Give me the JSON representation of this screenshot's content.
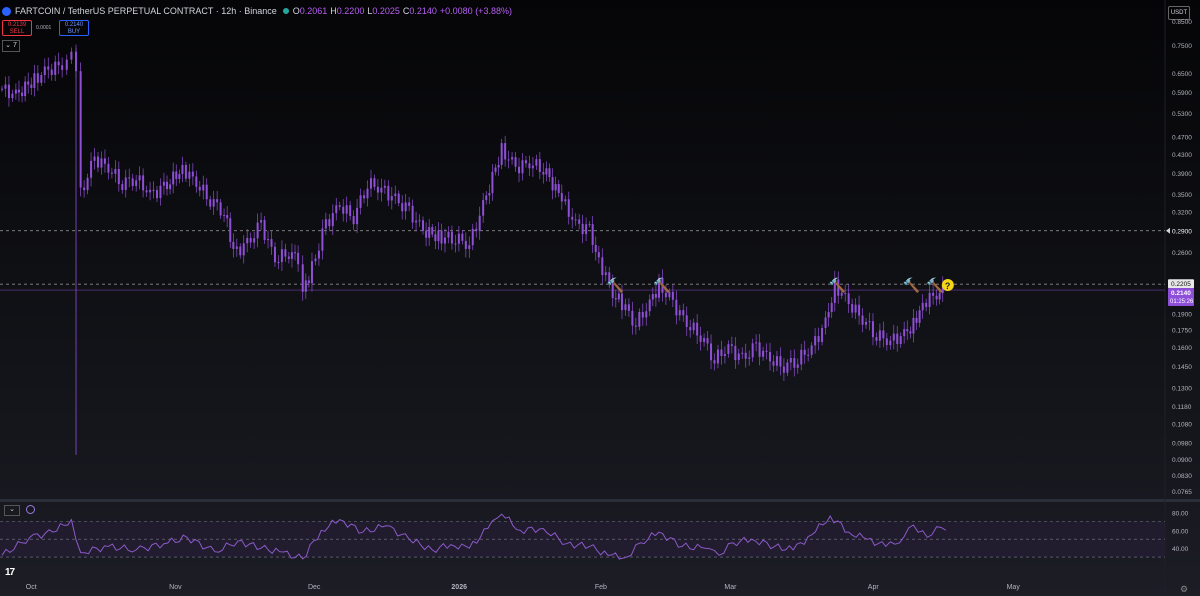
{
  "header": {
    "symbol": "FARTCOIN / TetherUS PERPETUAL CONTRACT · 12h · Binance",
    "open_label": "O",
    "open": "0.2061",
    "high_label": "H",
    "high": "0.2200",
    "low_label": "L",
    "low": "0.2025",
    "close_label": "C",
    "close": "0.2140",
    "change": "+0.0080 (+3.88%)"
  },
  "trade": {
    "sell_price": "0.2139",
    "sell_label": "SELL",
    "spread": "0.0001",
    "buy_price": "0.2140",
    "buy_label": "BUY"
  },
  "indicator_toggle": "7",
  "currency_button": "USDT",
  "colors": {
    "candle": "#8f4fd6",
    "rsi": "#8c59c9",
    "price_label": "#8d4ed8",
    "emoji": "#f5d515"
  },
  "icons": [
    "hammer-emoji-icon",
    "question-emoji-icon",
    "tradingview-logo-icon",
    "settings-gear-icon",
    "collapse-chevron-icon"
  ],
  "chart_data": {
    "type": "line",
    "title": "FARTCOIN / TetherUS PERPETUAL CONTRACT · 12h · Binance",
    "xlabel": "",
    "ylabel": "",
    "log_scale": true,
    "ylim": [
      0.073,
      0.88
    ],
    "x_ticks": [
      "Oct",
      "Nov",
      "Dec",
      "2026",
      "Feb",
      "Mar",
      "Apr",
      "May"
    ],
    "y_ticks": [
      "0.8500",
      "0.7500",
      "0.6500",
      "0.5900",
      "0.5300",
      "0.4700",
      "0.4300",
      "0.3900",
      "0.3500",
      "0.3200",
      "0.2900",
      "0.2600",
      "0.1900",
      "0.1750",
      "0.1600",
      "0.1450",
      "0.1300",
      "0.1180",
      "0.1080",
      "0.0980",
      "0.0900",
      "0.0830",
      "0.0765"
    ],
    "price_levels": {
      "dashed_resistance": "0.2900",
      "dashed_level": "0.2205",
      "last_price": "0.2140",
      "countdown": "01:25:26"
    },
    "series": [
      {
        "values": [
          [
            "2025-09-25",
            0.6
          ],
          [
            "2025-09-28",
            0.58
          ],
          [
            "2025-10-02",
            0.63
          ],
          [
            "2025-10-05",
            0.66
          ],
          [
            "2025-10-08",
            0.68
          ],
          [
            "2025-10-09",
            0.72
          ],
          [
            "2025-10-10",
            0.73
          ],
          [
            "2025-10-11",
            0.64
          ],
          [
            "2025-10-12",
            0.35
          ],
          [
            "2025-10-15",
            0.42
          ],
          [
            "2025-10-18",
            0.4
          ],
          [
            "2025-10-21",
            0.37
          ],
          [
            "2025-10-24",
            0.38
          ],
          [
            "2025-10-27",
            0.35
          ],
          [
            "2025-10-30",
            0.36
          ],
          [
            "2025-11-03",
            0.4
          ],
          [
            "2025-11-06",
            0.37
          ],
          [
            "2025-11-09",
            0.34
          ],
          [
            "2025-11-12",
            0.32
          ],
          [
            "2025-11-14",
            0.26
          ],
          [
            "2025-11-17",
            0.27
          ],
          [
            "2025-11-20",
            0.3
          ],
          [
            "2025-11-23",
            0.25
          ],
          [
            "2025-11-26",
            0.26
          ],
          [
            "2025-11-28",
            0.25
          ],
          [
            "2025-11-29",
            0.21
          ],
          [
            "2025-12-01",
            0.24
          ],
          [
            "2025-12-04",
            0.3
          ],
          [
            "2025-12-07",
            0.33
          ],
          [
            "2025-12-10",
            0.31
          ],
          [
            "2025-12-13",
            0.37
          ],
          [
            "2025-12-16",
            0.36
          ],
          [
            "2025-12-19",
            0.34
          ],
          [
            "2025-12-22",
            0.32
          ],
          [
            "2025-12-25",
            0.29
          ],
          [
            "2025-12-29",
            0.28
          ],
          [
            "2026-01-01",
            0.28
          ],
          [
            "2026-01-04",
            0.27
          ],
          [
            "2026-01-07",
            0.33
          ],
          [
            "2026-01-11",
            0.44
          ],
          [
            "2026-01-14",
            0.4
          ],
          [
            "2026-01-17",
            0.41
          ],
          [
            "2026-01-20",
            0.4
          ],
          [
            "2026-01-24",
            0.34
          ],
          [
            "2026-01-27",
            0.3
          ],
          [
            "2026-01-30",
            0.29
          ],
          [
            "2026-02-01",
            0.25
          ],
          [
            "2026-02-04",
            0.21
          ],
          [
            "2026-02-06",
            0.2
          ],
          [
            "2026-02-09",
            0.18
          ],
          [
            "2026-02-12",
            0.2
          ],
          [
            "2026-02-14",
            0.22
          ],
          [
            "2026-02-17",
            0.2
          ],
          [
            "2026-02-20",
            0.18
          ],
          [
            "2026-02-23",
            0.17
          ],
          [
            "2026-02-26",
            0.15
          ],
          [
            "2026-03-01",
            0.16
          ],
          [
            "2026-03-04",
            0.15
          ],
          [
            "2026-03-07",
            0.16
          ],
          [
            "2026-03-10",
            0.15
          ],
          [
            "2026-03-13",
            0.145
          ],
          [
            "2026-03-16",
            0.15
          ],
          [
            "2026-03-19",
            0.16
          ],
          [
            "2026-03-22",
            0.18
          ],
          [
            "2026-03-24",
            0.22
          ],
          [
            "2026-03-27",
            0.2
          ],
          [
            "2026-03-30",
            0.185
          ],
          [
            "2026-04-02",
            0.17
          ],
          [
            "2026-04-05",
            0.165
          ],
          [
            "2026-04-08",
            0.17
          ],
          [
            "2026-04-10",
            0.18
          ],
          [
            "2026-04-12",
            0.2
          ],
          [
            "2026-04-15",
            0.21
          ],
          [
            "2026-04-17",
            0.214
          ]
        ]
      }
    ],
    "annotations": [
      "🔨",
      "🔨",
      "🔨",
      "🔨",
      "🔨",
      "❓"
    ],
    "rsi": {
      "ylim": [
        20,
        85
      ],
      "y_ticks": [
        "80.00",
        "60.00",
        "40.00"
      ],
      "bands": [
        70,
        50,
        30
      ],
      "values": [
        [
          "2025-09-25",
          32
        ],
        [
          "2025-10-01",
          52
        ],
        [
          "2025-10-06",
          58
        ],
        [
          "2025-10-10",
          72
        ],
        [
          "2025-10-12",
          35
        ],
        [
          "2025-10-18",
          42
        ],
        [
          "2025-10-24",
          38
        ],
        [
          "2025-10-30",
          45
        ],
        [
          "2025-11-04",
          52
        ],
        [
          "2025-11-10",
          36
        ],
        [
          "2025-11-15",
          48
        ],
        [
          "2025-11-20",
          40
        ],
        [
          "2025-11-24",
          36
        ],
        [
          "2025-11-29",
          28
        ],
        [
          "2025-12-03",
          60
        ],
        [
          "2025-12-07",
          72
        ],
        [
          "2025-12-12",
          58
        ],
        [
          "2025-12-17",
          65
        ],
        [
          "2025-12-22",
          50
        ],
        [
          "2025-12-27",
          38
        ],
        [
          "2025-12-31",
          44
        ],
        [
          "2026-01-04",
          40
        ],
        [
          "2026-01-08",
          62
        ],
        [
          "2026-01-11",
          78
        ],
        [
          "2026-01-15",
          60
        ],
        [
          "2026-01-20",
          62
        ],
        [
          "2026-01-25",
          45
        ],
        [
          "2026-01-30",
          42
        ],
        [
          "2026-02-03",
          32
        ],
        [
          "2026-02-07",
          30
        ],
        [
          "2026-02-10",
          46
        ],
        [
          "2026-02-14",
          58
        ],
        [
          "2026-02-19",
          42
        ],
        [
          "2026-02-24",
          40
        ],
        [
          "2026-02-27",
          32
        ],
        [
          "2026-03-02",
          46
        ],
        [
          "2026-03-06",
          50
        ],
        [
          "2026-03-11",
          42
        ],
        [
          "2026-03-15",
          38
        ],
        [
          "2026-03-19",
          55
        ],
        [
          "2026-03-23",
          76
        ],
        [
          "2026-03-27",
          58
        ],
        [
          "2026-03-31",
          50
        ],
        [
          "2026-04-04",
          42
        ],
        [
          "2026-04-07",
          46
        ],
        [
          "2026-04-10",
          66
        ],
        [
          "2026-04-13",
          52
        ],
        [
          "2026-04-15",
          64
        ],
        [
          "2026-04-17",
          60
        ]
      ]
    }
  }
}
